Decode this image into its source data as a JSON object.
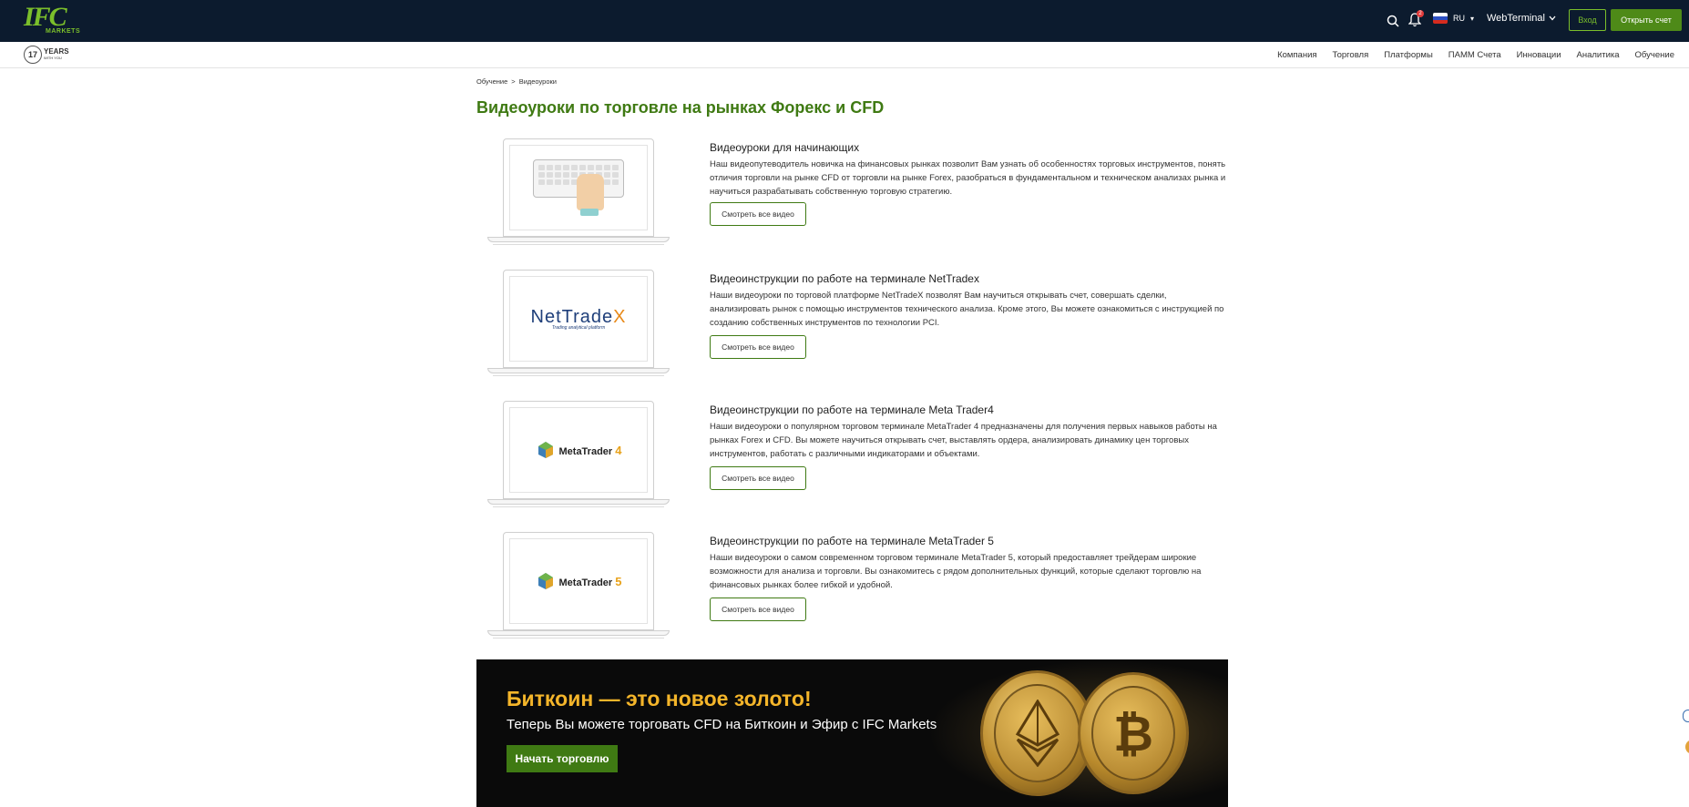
{
  "header": {
    "logo_text": "IFC",
    "logo_sub": "MARKETS",
    "notifications_count": "2",
    "language": "RU",
    "webterminal_label": "WebTerminal",
    "login_label": "Вход",
    "open_account_label": "Открыть счет"
  },
  "subnav": {
    "years_number": "17",
    "years_label": "YEARS",
    "years_sub": "WITH YOU",
    "links": [
      "Компания",
      "Торговля",
      "Платформы",
      "ПАММ Счета",
      "Инновации",
      "Аналитика",
      "Обучение"
    ]
  },
  "breadcrumb": {
    "items": [
      "Обучение",
      "Видеоуроки"
    ],
    "separator": ">"
  },
  "page_title": "Видеоуроки по торговле на рынках Форекс и CFD",
  "cards": [
    {
      "title": "Видеоуроки для начинающих",
      "description": "Наш видеопутеводитель новичка на финансовых рынках позволит Вам узнать об особенностях торговых инструментов, понять отличия торговли на рынке CFD от торговли на рынке Forex, разобраться в фундаментальном и техническом анализах рынка и научиться разрабатывать собственную торговую стратегию.",
      "button": "Смотреть все видео",
      "image": "keyboard-hand-illustration"
    },
    {
      "title": "Видеоинструкции по работе на терминале NetTradex",
      "description": "Наши видеоуроки по торговой платформе NetTradeX позволят Вам научиться открывать счет, совершать сделки, анализировать рынок с помощью инструментов технического анализа. Кроме этого, Вы можете ознакомиться с инструкцией по созданию собственных инструментов по технологии PCI.",
      "button": "Смотреть все видео",
      "image": "nettradex-logo",
      "logo_text_a": "NetTrade",
      "logo_text_b": "X",
      "logo_tagline": "Trading analytical platform"
    },
    {
      "title": "Видеоинструкции по работе на терминале Meta Trader4",
      "description": "Наши видеоуроки о популярном торговом терминале MetaTrader 4 предназначены для получения первых навыков работы на рынках Forex и CFD. Вы можете научиться открывать счет, выставлять ордера, анализировать динамику цен торговых инструментов, работать с различными индикаторами и объектами.",
      "button": "Смотреть все видео",
      "image": "metatrader4-logo",
      "logo_text": "MetaTrader",
      "logo_num": "4"
    },
    {
      "title": "Видеоинструкции по работе на терминале MetaTrader 5",
      "description": "Наши видеоуроки о самом современном торговом терминале MetaTrader 5, который предоставляет трейдерам широкие возможности для анализа и торговли. Вы ознакомитесь с рядом дополнительных функций, которые сделают торговлю на финансовых рынках более гибкой и удобной.",
      "button": "Смотреть все видео",
      "image": "metatrader5-logo",
      "logo_text": "MetaTrader",
      "logo_num": "5"
    }
  ],
  "banner": {
    "title": "Биткоин — это новое золото!",
    "subtitle": "Теперь Вы можете торговать CFD на Биткоин и Эфир с IFC Markets",
    "button": "Начать торговлю",
    "bitcoin_symbol": "₿"
  },
  "colors": {
    "header_bg": "#0c1b2e",
    "brand_green": "#7bbf2b",
    "title_green": "#3f7a13",
    "banner_gold": "#f4b52a"
  }
}
